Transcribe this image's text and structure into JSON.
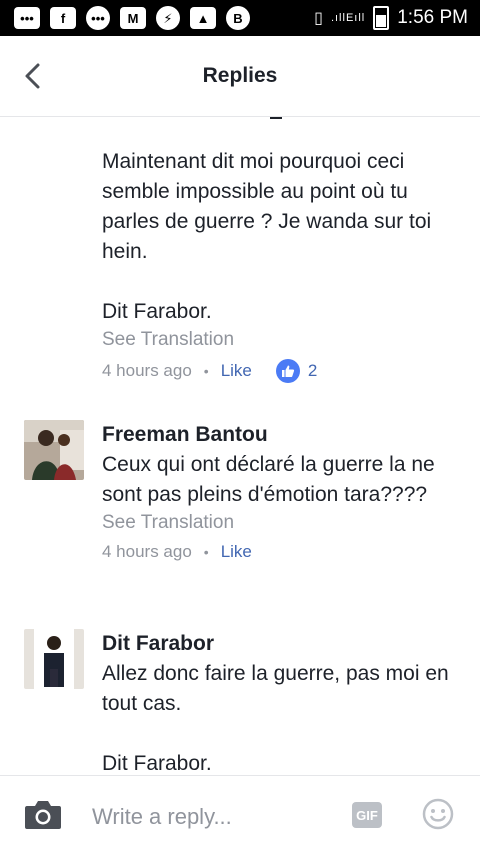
{
  "status_bar": {
    "time": "1:56 PM",
    "signal": "E",
    "icons": [
      "chat-bubbles-icon",
      "facebook-icon",
      "messenger-icon",
      "gmail-icon",
      "messenger-icon",
      "gallery-icon",
      "b-app-icon",
      "vibrate-icon",
      "signal-icon",
      "battery-icon"
    ]
  },
  "header": {
    "title": "Replies",
    "back_icon": "chevron-left-icon"
  },
  "thread": {
    "first_comment": {
      "paragraph1": "Maintenant dit moi pourquoi ceci semble impossible au point où tu parles de guerre ? Je wanda sur toi hein.",
      "paragraph2": "Dit Farabor.",
      "see_translation": "See Translation",
      "time": "4 hours ago",
      "like": "Like",
      "reaction_count": "2"
    },
    "comments": [
      {
        "author": "Freeman Bantou",
        "text": "Ceux qui ont déclaré la guerre la ne sont pas pleins d'émotion tara????",
        "see_translation": "See Translation",
        "time": "4 hours ago",
        "like": "Like"
      },
      {
        "author": "Dit Farabor",
        "text": "Allez donc faire la guerre, pas moi en tout cas.",
        "signature": "Dit Farabor."
      }
    ]
  },
  "composer": {
    "placeholder": "Write a reply...",
    "gif_label": "GIF"
  },
  "colors": {
    "link_blue": "#4267b2",
    "reaction_blue": "#4b7bf5",
    "meta_gray": "#90949c"
  }
}
